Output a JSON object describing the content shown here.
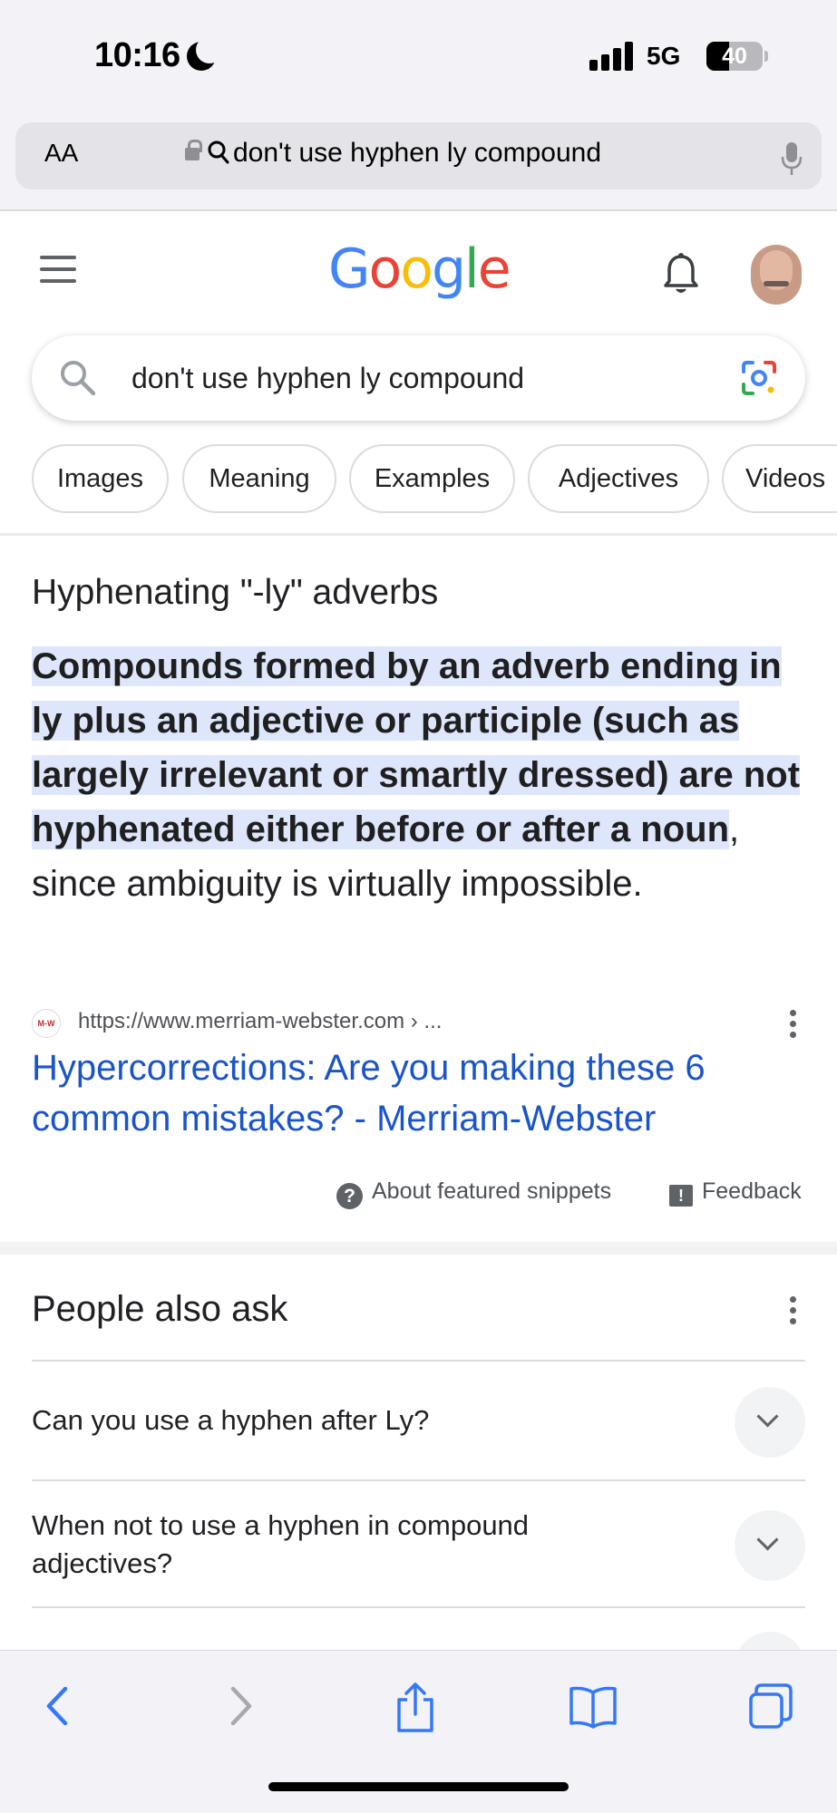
{
  "status_bar": {
    "time": "10:16",
    "network": "5G",
    "battery": "40"
  },
  "address_bar": {
    "text_size_label": "AA",
    "url_text": "don't use hyphen ly compound"
  },
  "google": {
    "logo_letters": [
      {
        "char": "G",
        "color": "#4285F4"
      },
      {
        "char": "o",
        "color": "#EA4335"
      },
      {
        "char": "o",
        "color": "#FBBC05"
      },
      {
        "char": "g",
        "color": "#4285F4"
      },
      {
        "char": "l",
        "color": "#34A853"
      },
      {
        "char": "e",
        "color": "#EA4335"
      }
    ],
    "search_query": "don't use hyphen ly compound",
    "chips": [
      "Images",
      "Meaning",
      "Examples",
      "Adjectives",
      "Videos"
    ]
  },
  "featured_snippet": {
    "heading": "Hyphenating \"-ly\" adverbs",
    "highlighted_text": "Compounds formed by an adverb ending in ly plus an adjective or participle (such as largely irrelevant or smartly dressed) are not hyphenated either before or after a noun",
    "rest_text": ", since ambiguity is virtually impossible.",
    "source_favicon": "M-W",
    "source_url": "https://www.merriam-webster.com › ...",
    "link_title": "Hypercorrections: Are you making these 6 common mistakes? - Merriam-Webster",
    "about_label": "About featured snippets",
    "feedback_label": "Feedback"
  },
  "people_also_ask": {
    "title": "People also ask",
    "questions": [
      "Can you use a hyphen after Ly?",
      "When not to use a hyphen in compound adjectives?"
    ]
  },
  "colors": {
    "link": "#1a55c8",
    "highlight": "#dde6fb",
    "safari_chrome": "#f2f2f7",
    "safari_blue": "#3478f6"
  }
}
